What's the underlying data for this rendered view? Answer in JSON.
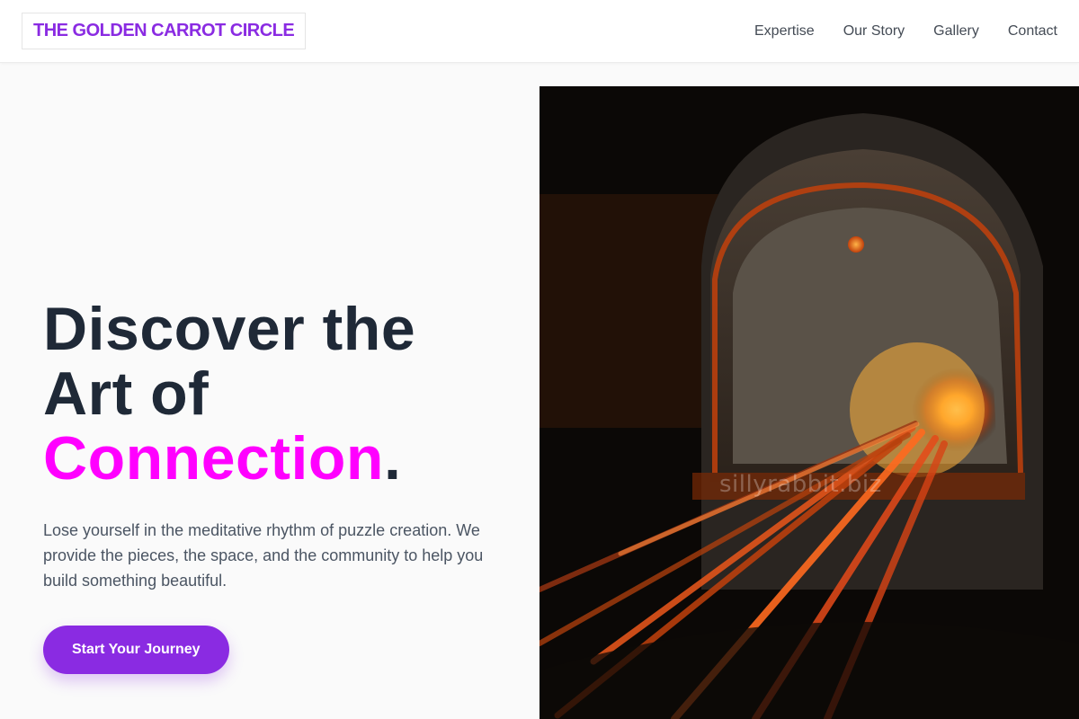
{
  "brand": {
    "name": "THE GOLDEN CARROT CIRCLE",
    "color": "#8a2be2"
  },
  "nav": {
    "items": [
      {
        "label": "Expertise"
      },
      {
        "label": "Our Story"
      },
      {
        "label": "Gallery"
      },
      {
        "label": "Contact"
      }
    ]
  },
  "hero": {
    "headline_line1": "Discover the",
    "headline_line2": "Art of",
    "headline_accent": "Connection",
    "headline_period": ".",
    "accent_color": "#ff00ff",
    "description": "Lose yourself in the meditative rhythm of puzzle creation. We provide the pieces, the space, and the community to help you build something beautiful.",
    "cta_label": "Start Your Journey",
    "image_watermark": "sillyrabbit.biz"
  }
}
